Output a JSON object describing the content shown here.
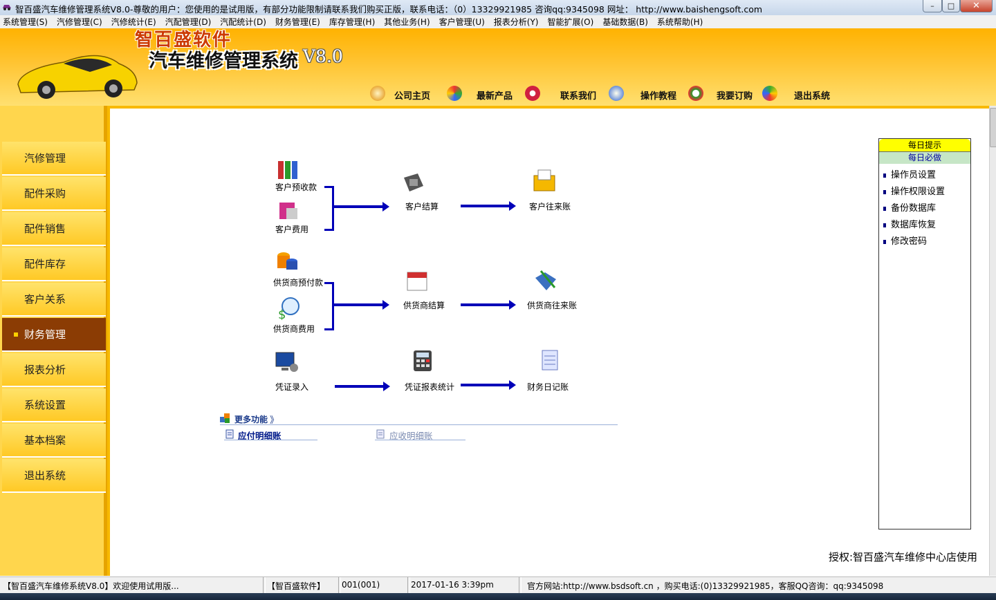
{
  "window": {
    "title": "智百盛汽车维修管理系统V8.0-尊敬的用户：您使用的是试用版，有部分功能限制请联系我们购买正版，联系电话：（0）13329921985  咨询qq:9345098   网址： http://www.baishengsoft.com",
    "minimize_label": "–",
    "maximize_label": "□",
    "close_label": "✕"
  },
  "menu": [
    "系统管理(S)",
    "汽修管理(C)",
    "汽修统计(E)",
    "汽配管理(D)",
    "汽配统计(D)",
    "财务管理(E)",
    "库存管理(H)",
    "其他业务(H)",
    "客户管理(U)",
    "报表分析(Y)",
    "智能扩展(O)",
    "基础数据(B)",
    "系统帮助(H)"
  ],
  "header": {
    "logo_line1": "智百盛软件",
    "logo_line2": "汽车维修管理系统",
    "logo_version": "V8.0",
    "links": [
      "公司主页",
      "最新产品",
      "联系我们",
      "操作教程",
      "我要订购",
      "退出系统"
    ]
  },
  "sidebar": {
    "items": [
      "汽修管理",
      "配件采购",
      "配件销售",
      "配件库存",
      "客户关系",
      "财务管理",
      "报表分析",
      "系统设置",
      "基本档案",
      "退出系统"
    ],
    "active_index": 5
  },
  "flow": {
    "customer_prepay": "客户预收款",
    "customer_fee": "客户费用",
    "customer_settle": "客户结算",
    "customer_account": "客户往来账",
    "supplier_prepay": "供货商预付款",
    "supplier_fee": "供货商费用",
    "supplier_settle": "供货商结算",
    "supplier_account": "供货商往来账",
    "voucher_entry": "凭证录入",
    "voucher_stats": "凭证报表统计",
    "finance_journal": "财务日记账"
  },
  "more": {
    "title": "更多功能",
    "chevron": "》",
    "link1": "应付明细账",
    "link2": "应收明细账"
  },
  "tips": {
    "header": "每日提示",
    "subheader": "每日必做",
    "items": [
      "操作员设置",
      "操作权限设置",
      "备份数据库",
      "数据库恢复",
      "修改密码"
    ]
  },
  "license": "授权:智百盛汽车维修中心店使用",
  "status": {
    "welcome": "【智百盛汽车维修系统V8.0】欢迎使用试用版...",
    "company": "【智百盛软件】",
    "user": "001(001)",
    "datetime": "2017-01-16  3:39pm",
    "contact": "官方网站:http://www.bsdsoft.cn ，购买电话:(0)13329921985，客服QQ咨询：qq:9345098"
  },
  "colors": {
    "header_orange": "#ffb200",
    "sidebar_yellow": "#ffd64d",
    "active_brown": "#8b3c04",
    "arrow_blue": "#0000b8"
  }
}
